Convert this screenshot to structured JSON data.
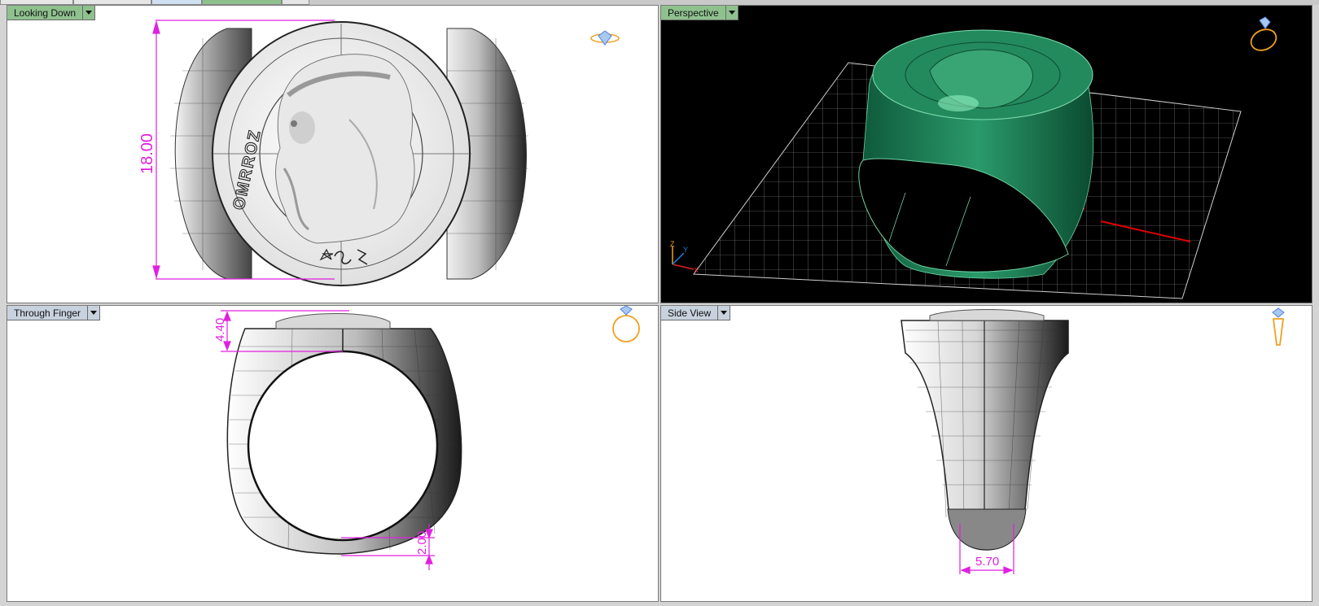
{
  "viewports": {
    "top_left": {
      "label": "Looking Down",
      "engraving": "OMRROZ",
      "dimension": "18.00"
    },
    "top_right": {
      "label": "Perspective",
      "axis_z": "Z",
      "axis_y": "Y",
      "axis_x": "X"
    },
    "bottom_left": {
      "label": "Through Finger",
      "dimension_top": "4.40",
      "dimension_bottom": "2.00"
    },
    "bottom_right": {
      "label": "Side View",
      "dimension_bottom": "5.70"
    }
  },
  "colors": {
    "dimension": "#e020e0",
    "active_label": "#8fc18f",
    "model_green": "#1f7a55",
    "icon_orange": "#f0a020",
    "icon_blue": "#5080e0"
  },
  "icons": [
    "diamond-ring-top-icon",
    "ring-perspective-icon",
    "ring-front-icon",
    "ring-side-icon"
  ]
}
